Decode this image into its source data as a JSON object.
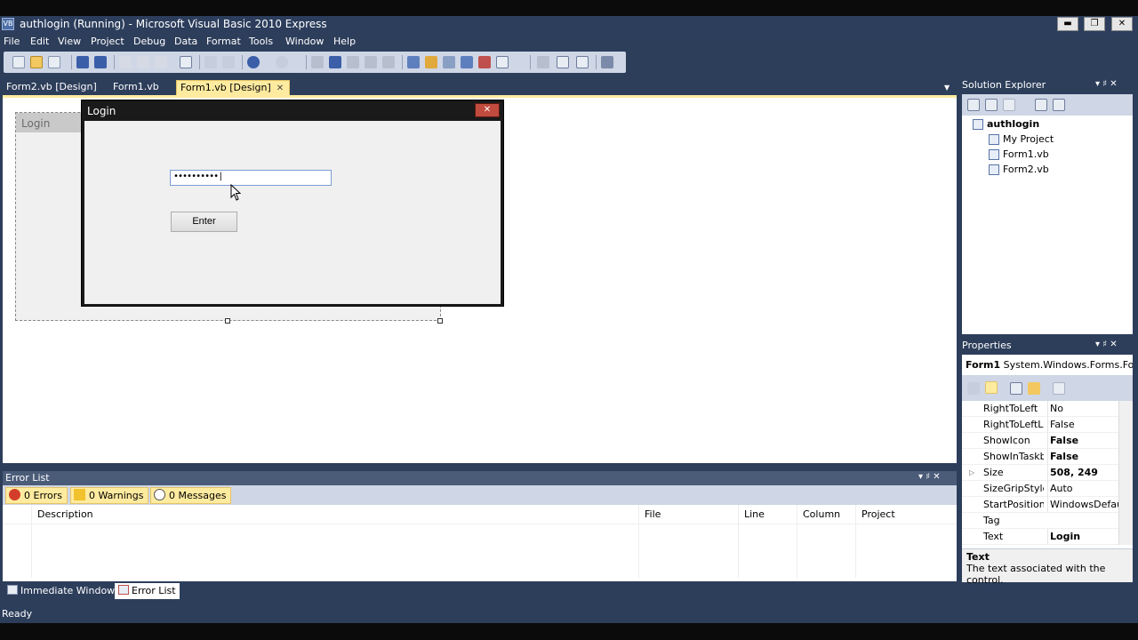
{
  "window": {
    "title": "authlogin (Running) - Microsoft Visual Basic 2010 Express",
    "app_icon_label": "VB",
    "minimize": "▬",
    "maximize": "❐",
    "close": "✕"
  },
  "menu": [
    "File",
    "Edit",
    "View",
    "Project",
    "Debug",
    "Data",
    "Format",
    "Tools",
    "Window",
    "Help"
  ],
  "doc_tabs": {
    "tab1": "Form2.vb [Design]",
    "tab2": "Form1.vb",
    "tab3": "Form1.vb [Design]",
    "close_glyph": "✕",
    "dropdown_glyph": "▼"
  },
  "designer": {
    "form_title": "Login"
  },
  "login_window": {
    "title": "Login",
    "close_glyph": "✕",
    "password_value": "••••••••••|",
    "enter_label": "Enter"
  },
  "solution_explorer": {
    "title": "Solution Explorer",
    "pin": "▾ ♯ ✕",
    "project": "authlogin",
    "items": [
      "My Project",
      "Form1.vb",
      "Form2.vb"
    ]
  },
  "properties": {
    "title": "Properties",
    "pin": "▾ ♯ ✕",
    "object_name": "Form1",
    "object_type": "System.Windows.Forms.Fo",
    "rows": [
      {
        "name": "RightToLeft",
        "value": "No",
        "bold": false
      },
      {
        "name": "RightToLeftLa",
        "value": "False",
        "bold": false
      },
      {
        "name": "ShowIcon",
        "value": "False",
        "bold": true
      },
      {
        "name": "ShowInTaskb",
        "value": "False",
        "bold": true
      },
      {
        "name": "Size",
        "value": "508, 249",
        "bold": true
      },
      {
        "name": "SizeGripStyle",
        "value": "Auto",
        "bold": false
      },
      {
        "name": "StartPosition",
        "value": "WindowsDefault",
        "bold": false
      },
      {
        "name": "Tag",
        "value": "",
        "bold": false
      },
      {
        "name": "Text",
        "value": "Login",
        "bold": true
      }
    ],
    "expander_glyph": "▷",
    "desc_title": "Text",
    "desc_body": "The text associated with the control."
  },
  "error_list": {
    "title": "Error List",
    "pin": "▾ ♯ ✕",
    "errors": "0 Errors",
    "warnings": "0 Warnings",
    "messages": "0 Messages",
    "columns": [
      "Description",
      "File",
      "Line",
      "Column",
      "Project"
    ]
  },
  "bottom_tabs": {
    "immediate": "Immediate Window",
    "errorlist": "Error List"
  },
  "status": "Ready"
}
